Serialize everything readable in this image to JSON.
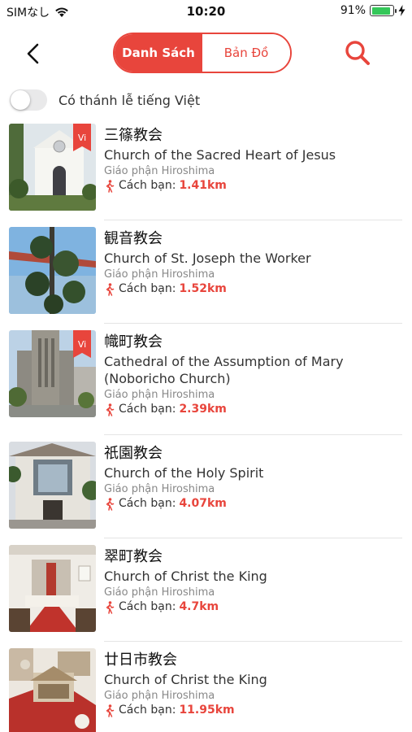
{
  "status_bar": {
    "carrier": "SIMなし",
    "time": "10:20",
    "battery_percent": "91%",
    "battery_level": 0.91
  },
  "nav": {
    "back_icon": "chevron-left-icon",
    "tabs": [
      {
        "label": "Danh Sách",
        "active": true
      },
      {
        "label": "Bản Đồ",
        "active": false
      }
    ],
    "search_icon": "search-icon"
  },
  "filter": {
    "label": "Có thánh lễ tiếng Việt",
    "enabled": false
  },
  "distance_prefix": "Cách bạn:",
  "churches": [
    {
      "name_jp": "三篠教会",
      "name_en": "Church of the Sacred Heart of Jesus",
      "diocese": "Giáo phận Hiroshima",
      "distance": "1.41km",
      "badge": "Vi"
    },
    {
      "name_jp": "観音教会",
      "name_en": "Church of St. Joseph the Worker",
      "diocese": "Giáo phận Hiroshima",
      "distance": "1.52km",
      "badge": ""
    },
    {
      "name_jp": "幟町教会",
      "name_en": "Cathedral of the Assumption of Mary (Noboricho Church)",
      "diocese": "Giáo phận Hiroshima",
      "distance": "2.39km",
      "badge": "Vi"
    },
    {
      "name_jp": "祇園教会",
      "name_en": "Church of the Holy Spirit",
      "diocese": "Giáo phận Hiroshima",
      "distance": "4.07km",
      "badge": ""
    },
    {
      "name_jp": "翠町教会",
      "name_en": "Church of Christ the King",
      "diocese": "Giáo phận Hiroshima",
      "distance": "4.7km",
      "badge": ""
    },
    {
      "name_jp": "廿日市教会",
      "name_en": "Church of Christ the King",
      "diocese": "Giáo phận Hiroshima",
      "distance": "11.95km",
      "badge": ""
    }
  ],
  "colors": {
    "accent": "#e8453c",
    "battery": "#34c759"
  }
}
